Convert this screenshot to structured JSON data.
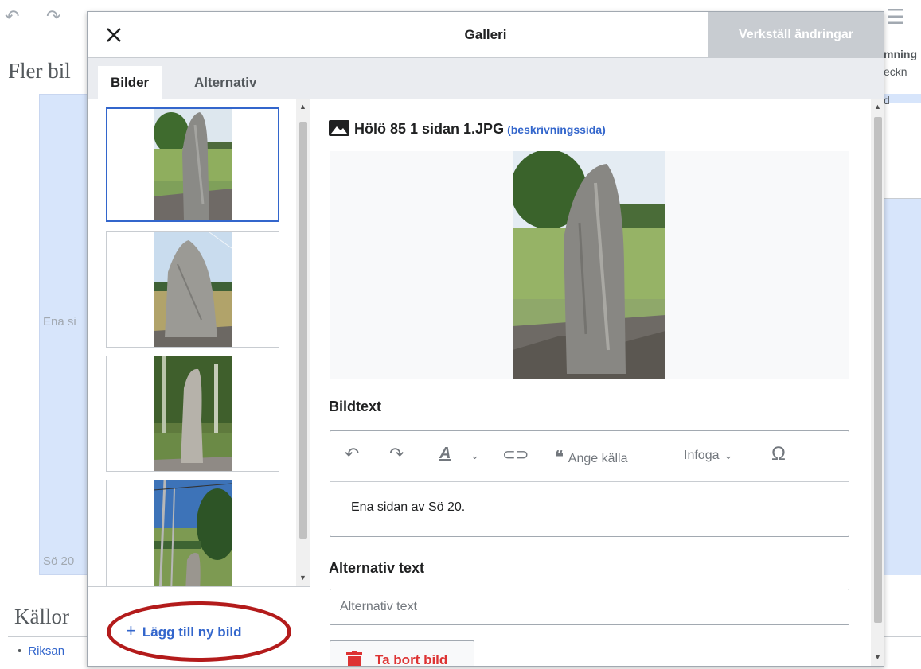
{
  "background": {
    "heading_more_images": "Fler bil",
    "caption_1": "Ena si",
    "caption_2": "Sö 20",
    "heading_sources": "Källor",
    "source_item": "Riksan",
    "right_text_1": "mning",
    "right_text_2": "eckn",
    "right_text_3": "d"
  },
  "dialog": {
    "title": "Galleri",
    "apply_label": "Verkställ ändringar",
    "tabs": [
      {
        "label": "Bilder",
        "active": true
      },
      {
        "label": "Alternativ",
        "active": false
      }
    ],
    "add_image_label": "Lägg till ny bild",
    "file_name": "Hölö 85 1 sidan 1.JPG",
    "description_link": "(beskrivningssida)",
    "caption_section_label": "Bildtext",
    "toolbar": {
      "cite_label": "Ange källa",
      "insert_label": "Infoga",
      "special_char": "Ω"
    },
    "caption_text": "Ena sidan av Sö 20.",
    "alt_section_label": "Alternativ text",
    "alt_placeholder": "Alternativ text",
    "delete_label": "Ta bort bild"
  },
  "colors": {
    "accent": "#3366cc",
    "destructive": "#d33",
    "annotation": "#b31b1b",
    "disabled_button": "#c8ccd1"
  }
}
